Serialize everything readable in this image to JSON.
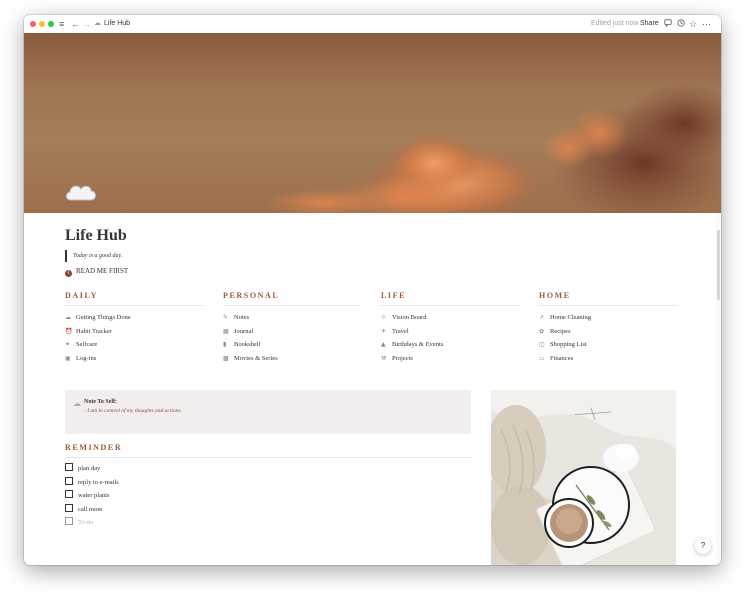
{
  "window": {
    "traffic_colors": [
      "#ff5f57",
      "#febc2e",
      "#28c840"
    ],
    "menu_icon": "hamburger-icon",
    "back_icon": "arrow-left-icon",
    "forward_icon": "arrow-right-icon",
    "page_icon": "cloud-icon",
    "breadcrumb": "Life Hub",
    "edited": "Edited just now",
    "share_label": "Share",
    "toolbar_icons": [
      "comment-icon",
      "clock-icon",
      "star-icon",
      "more-icon"
    ]
  },
  "page": {
    "title": "Life Hub",
    "quote": "Today is a good day.",
    "readme": "READ ME FIRST",
    "accent": "#9c5b3a"
  },
  "sections": [
    {
      "heading": "DAILY",
      "items": [
        {
          "icon": "cloud-icon",
          "label": "Getting Things Done"
        },
        {
          "icon": "alarm-clock-icon",
          "label": "Habit Tracker"
        },
        {
          "icon": "sparkle-icon",
          "label": "Selfcare"
        },
        {
          "icon": "lock-icon",
          "label": "Log-ins"
        }
      ]
    },
    {
      "heading": "PERSONAL",
      "items": [
        {
          "icon": "pencil-icon",
          "label": "Notes"
        },
        {
          "icon": "book-open-icon",
          "label": "Journal"
        },
        {
          "icon": "book-icon",
          "label": "Bookshelf"
        },
        {
          "icon": "film-icon",
          "label": "Movies & Series"
        }
      ]
    },
    {
      "heading": "LIFE",
      "items": [
        {
          "icon": "sun-icon",
          "label": "Vision Board"
        },
        {
          "icon": "airplane-icon",
          "label": "Travel"
        },
        {
          "icon": "cake-icon",
          "label": "Birthdays & Events"
        },
        {
          "icon": "hammer-icon",
          "label": "Projects"
        }
      ]
    },
    {
      "heading": "HOME",
      "items": [
        {
          "icon": "broom-icon",
          "label": "Home Cleaning"
        },
        {
          "icon": "leaf-icon",
          "label": "Recipes"
        },
        {
          "icon": "cart-icon",
          "label": "Shopping List"
        },
        {
          "icon": "money-icon",
          "label": "Finances"
        }
      ]
    }
  ],
  "note": {
    "title": "Note To Self:",
    "body": "- I am in control of my thoughts and actions."
  },
  "reminder": {
    "heading": "REMINDER",
    "items": [
      {
        "label": "plan day",
        "checked": false
      },
      {
        "label": "reply to e-mails",
        "checked": false
      },
      {
        "label": "water plants",
        "checked": false
      },
      {
        "label": "call mom",
        "checked": false
      }
    ],
    "placeholder": "To-do"
  },
  "help_label": "?"
}
